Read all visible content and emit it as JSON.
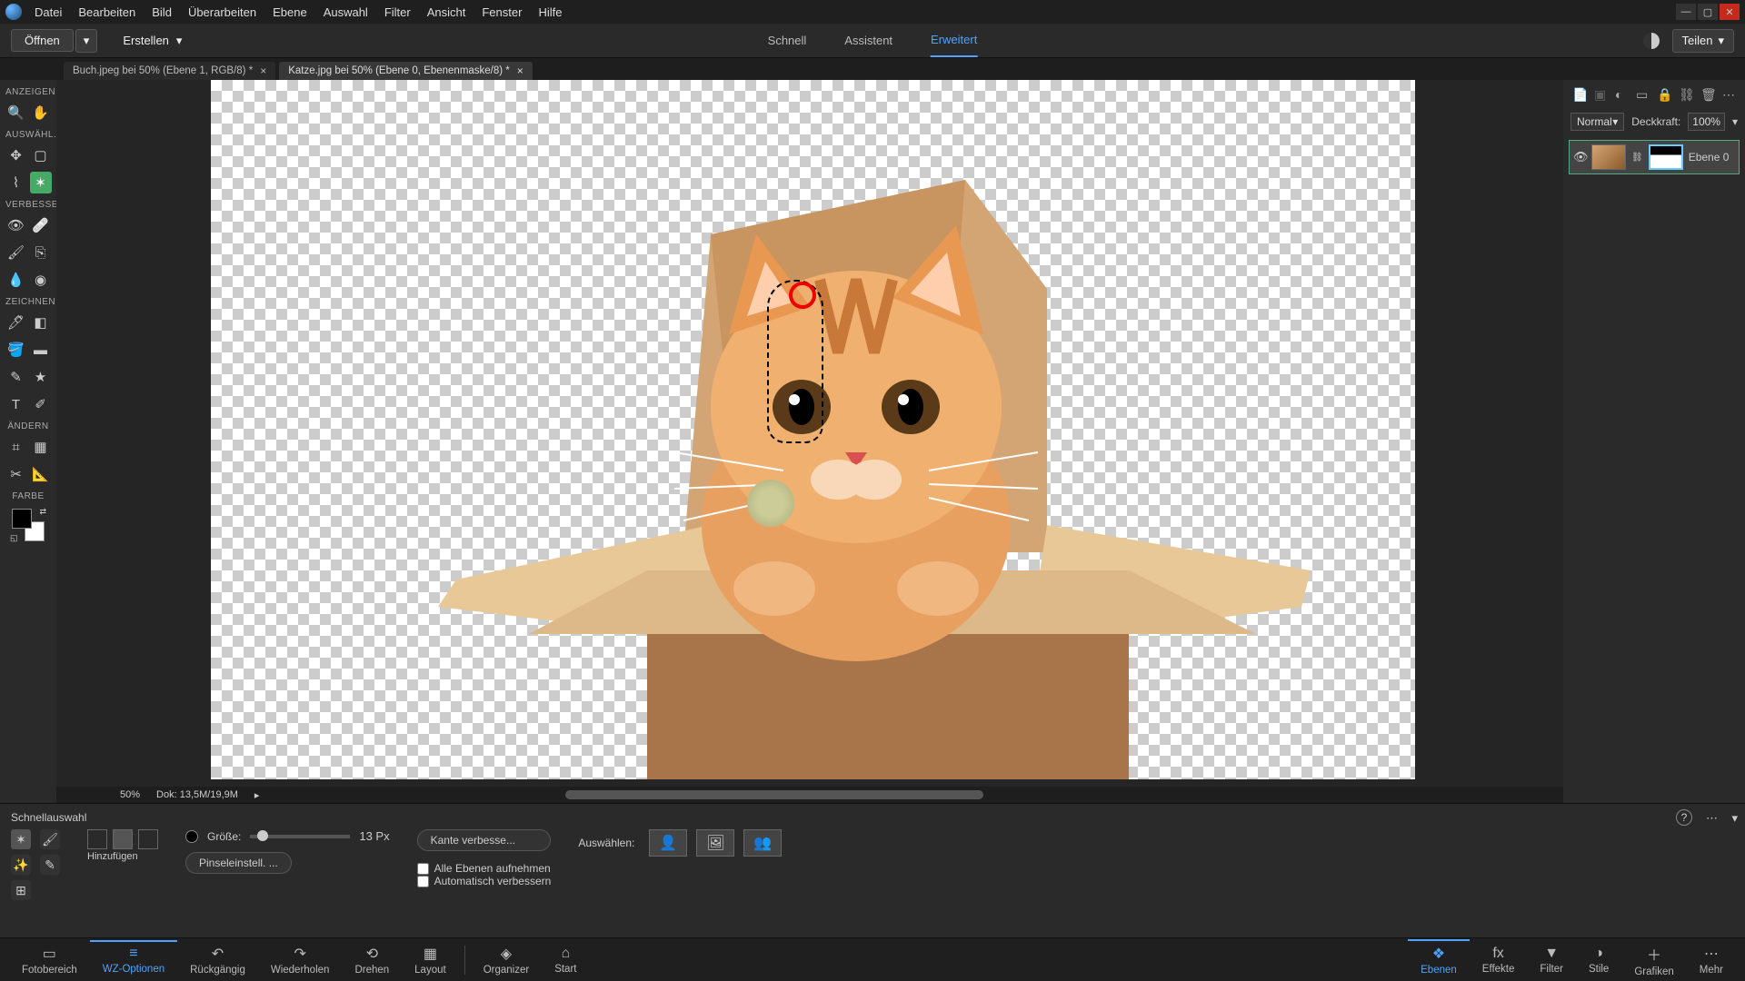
{
  "menu": {
    "items": [
      "Datei",
      "Bearbeiten",
      "Bild",
      "Überarbeiten",
      "Ebene",
      "Auswahl",
      "Filter",
      "Ansicht",
      "Fenster",
      "Hilfe"
    ]
  },
  "toolbar": {
    "open": "Öffnen",
    "create": "Erstellen",
    "share": "Teilen",
    "modes": {
      "quick": "Schnell",
      "guided": "Assistent",
      "expert": "Erweitert"
    }
  },
  "doc_tabs": [
    {
      "label": "Buch.jpeg bei 50% (Ebene 1, RGB/8) *"
    },
    {
      "label": "Katze.jpg bei 50% (Ebene 0, Ebenenmaske/8) *"
    }
  ],
  "tools": {
    "sections": {
      "view": "ANZEIGEN",
      "select": "AUSWÄHL...",
      "enhance": "VERBESSE...",
      "draw": "ZEICHNEN",
      "modify": "ÄNDERN",
      "color": "FARBE"
    }
  },
  "canvas": {
    "zoom": "50%",
    "doc_size": "Dok: 13,5M/19,9M"
  },
  "layers": {
    "blend": "Normal",
    "opacity_label": "Deckkraft:",
    "opacity_value": "100%",
    "layer0": "Ebene 0"
  },
  "options": {
    "tool_name": "Schnellauswahl",
    "mode_label": "Hinzufügen",
    "size_label": "Größe:",
    "size_value": "13 Px",
    "brush_settings": "Pinseleinstell. ...",
    "refine_edge": "Kante verbesse...",
    "all_layers": "Alle Ebenen aufnehmen",
    "auto_enhance": "Automatisch verbessern",
    "select_label": "Auswählen:"
  },
  "bottom": {
    "left": [
      {
        "label": "Fotobereich",
        "icon": "▭"
      },
      {
        "label": "WZ-Optionen",
        "icon": "≡"
      },
      {
        "label": "Rückgängig",
        "icon": "↶"
      },
      {
        "label": "Wiederholen",
        "icon": "↷"
      },
      {
        "label": "Drehen",
        "icon": "⟲"
      },
      {
        "label": "Layout",
        "icon": "▦"
      },
      {
        "label": "Organizer",
        "icon": "◈"
      },
      {
        "label": "Start",
        "icon": "⌂"
      }
    ],
    "right": [
      {
        "label": "Ebenen",
        "icon": "❖"
      },
      {
        "label": "Effekte",
        "icon": "fx"
      },
      {
        "label": "Filter",
        "icon": "▼"
      },
      {
        "label": "Stile",
        "icon": "◑"
      },
      {
        "label": "Grafiken",
        "icon": "＋"
      },
      {
        "label": "Mehr",
        "icon": "⋯"
      }
    ]
  }
}
